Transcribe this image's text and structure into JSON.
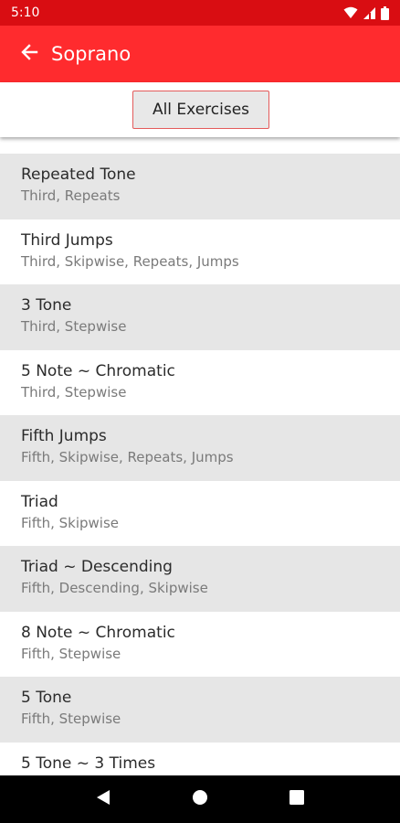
{
  "status": {
    "time": "5:10"
  },
  "app_bar": {
    "title": "Soprano"
  },
  "filter": {
    "label": "All Exercises"
  },
  "exercises": [
    {
      "title": "Repeated Tone",
      "tags": "Third, Repeats"
    },
    {
      "title": "Third Jumps",
      "tags": "Third, Skipwise, Repeats, Jumps"
    },
    {
      "title": "3 Tone",
      "tags": "Third, Stepwise"
    },
    {
      "title": "5 Note ~ Chromatic",
      "tags": "Third, Stepwise"
    },
    {
      "title": "Fifth Jumps",
      "tags": "Fifth, Skipwise, Repeats, Jumps"
    },
    {
      "title": "Triad",
      "tags": "Fifth, Skipwise"
    },
    {
      "title": "Triad ~ Descending",
      "tags": "Fifth, Descending, Skipwise"
    },
    {
      "title": "8 Note ~ Chromatic",
      "tags": "Fifth, Stepwise"
    },
    {
      "title": "5 Tone",
      "tags": "Fifth, Stepwise"
    },
    {
      "title": "5 Tone ~ 3 Times",
      "tags": ""
    }
  ],
  "colors": {
    "status_bar": "#d90d12",
    "app_bar": "#ff2b2e",
    "row_shade": "#e6e6e6",
    "filter_border": "#e35b5b"
  },
  "icons": {
    "back": "arrow-left-icon",
    "wifi": "wifi-icon",
    "signal": "signal-icon",
    "battery": "battery-icon",
    "nav_back": "triangle-back-icon",
    "nav_home": "circle-home-icon",
    "nav_recents": "square-recents-icon"
  }
}
